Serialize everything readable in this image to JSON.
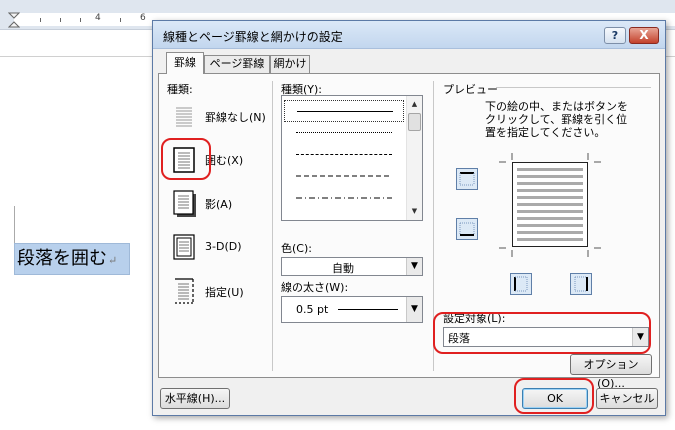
{
  "doc": {
    "ruler_numbers": [
      "4",
      "6"
    ],
    "paragraph_text": "段落を囲む",
    "return_mark": "↵"
  },
  "dialog": {
    "title": "線種とページ罫線と網かけの設定",
    "help_label": "?",
    "close_label": "X",
    "tabs": [
      {
        "label": "罫線",
        "active": true
      },
      {
        "label": "ページ罫線",
        "active": false
      },
      {
        "label": "網かけ",
        "active": false
      }
    ],
    "setting": {
      "heading": "種類:",
      "items": [
        {
          "label": "罫線なし(N)",
          "icon": "border-none-icon"
        },
        {
          "label": "囲む(X)",
          "icon": "border-box-icon",
          "selected": true
        },
        {
          "label": "影(A)",
          "icon": "border-shadow-icon"
        },
        {
          "label": "3-D(D)",
          "icon": "border-3d-icon"
        },
        {
          "label": "指定(U)",
          "icon": "border-custom-icon"
        }
      ]
    },
    "style": {
      "heading": "種類(Y):",
      "items": [
        "solid",
        "dotted",
        "dashed-small",
        "dashed",
        "dash-dot"
      ],
      "selected_index": 0
    },
    "color": {
      "label": "色(C):",
      "value": "自動"
    },
    "width": {
      "label": "線の太さ(W):",
      "value": "0.5 pt"
    },
    "preview": {
      "heading": "プレビュー",
      "instruction_lines": [
        "下の絵の中、またはボタンを",
        "クリックして、罫線を引く位",
        "置を指定してください。"
      ]
    },
    "apply_to": {
      "label": "設定対象(L):",
      "value": "段落"
    },
    "buttons": {
      "horizontal_line": "水平線(H)...",
      "options": "オプション(O)...",
      "ok": "OK",
      "cancel": "キャンセル"
    },
    "highlight_color": "#e02020",
    "accent_color": "#3c7fb1"
  }
}
